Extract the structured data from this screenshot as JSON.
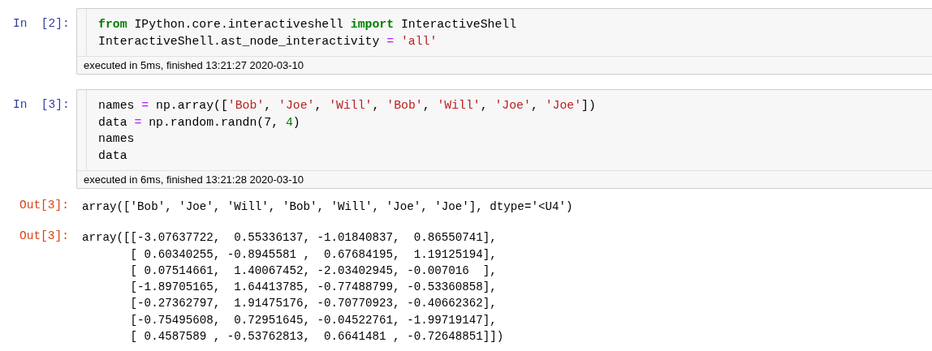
{
  "cells": [
    {
      "prompt": "In  [2]:",
      "code": [
        [
          {
            "kind": "keyword",
            "text": "from"
          },
          {
            "kind": "plain",
            "text": " IPython.core.interactiveshell "
          },
          {
            "kind": "keyword",
            "text": "import"
          },
          {
            "kind": "plain",
            "text": " InteractiveShell"
          }
        ],
        [
          {
            "kind": "plain",
            "text": "InteractiveShell.ast_node_interactivity "
          },
          {
            "kind": "operator",
            "text": "="
          },
          {
            "kind": "string",
            "text": " 'all'"
          }
        ]
      ],
      "timing": "executed in 5ms, finished 13:21:27 2020-03-10"
    },
    {
      "prompt": "In  [3]:",
      "code": [
        [
          {
            "kind": "plain",
            "text": "names "
          },
          {
            "kind": "operator",
            "text": "="
          },
          {
            "kind": "plain",
            "text": " np.array(["
          },
          {
            "kind": "string",
            "text": "'Bob'"
          },
          {
            "kind": "plain",
            "text": ", "
          },
          {
            "kind": "string",
            "text": "'Joe'"
          },
          {
            "kind": "plain",
            "text": ", "
          },
          {
            "kind": "string",
            "text": "'Will'"
          },
          {
            "kind": "plain",
            "text": ", "
          },
          {
            "kind": "string",
            "text": "'Bob'"
          },
          {
            "kind": "plain",
            "text": ", "
          },
          {
            "kind": "string",
            "text": "'Will'"
          },
          {
            "kind": "plain",
            "text": ", "
          },
          {
            "kind": "string",
            "text": "'Joe'"
          },
          {
            "kind": "plain",
            "text": ", "
          },
          {
            "kind": "string",
            "text": "'Joe'"
          },
          {
            "kind": "plain",
            "text": "])"
          }
        ],
        [
          {
            "kind": "plain",
            "text": "data "
          },
          {
            "kind": "operator",
            "text": "="
          },
          {
            "kind": "plain",
            "text": " np.random.randn(7, "
          },
          {
            "kind": "number",
            "text": "4"
          },
          {
            "kind": "plain",
            "text": ")"
          }
        ],
        [
          {
            "kind": "plain",
            "text": "names"
          }
        ],
        [
          {
            "kind": "plain",
            "text": "data"
          }
        ]
      ],
      "timing": "executed in 6ms, finished 13:21:28 2020-03-10",
      "outputs": [
        {
          "prompt": "Out[3]:",
          "lines": [
            "array(['Bob', 'Joe', 'Will', 'Bob', 'Will', 'Joe', 'Joe'], dtype='<U4')"
          ]
        },
        {
          "prompt": "Out[3]:",
          "lines": [
            "array([[-3.07637722,  0.55336137, -1.01840837,  0.86550741],",
            "       [ 0.60340255, -0.8945581 ,  0.67684195,  1.19125194],",
            "       [ 0.07514661,  1.40067452, -2.03402945, -0.007016  ],",
            "       [-1.89705165,  1.64413785, -0.77488799, -0.53360858],",
            "       [-0.27362797,  1.91475176, -0.70770923, -0.40662362],",
            "       [-0.75495608,  0.72951645, -0.04522761, -1.99719147],",
            "       [ 0.4587589 , -0.53762813,  0.6641481 , -0.72648851]])"
          ]
        }
      ]
    }
  ]
}
